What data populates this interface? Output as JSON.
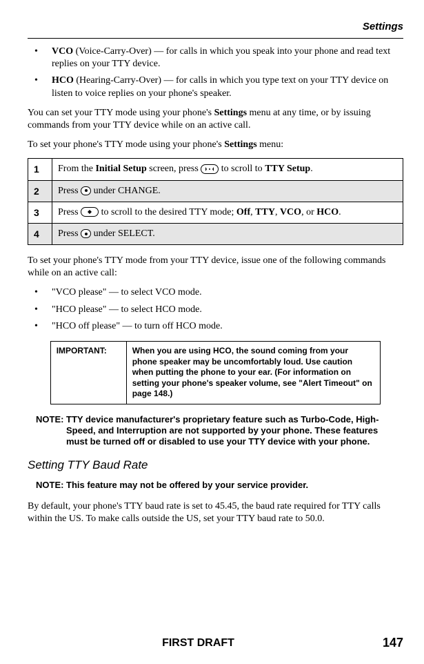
{
  "header": {
    "section": "Settings"
  },
  "bullets_top": [
    {
      "abbr": "VCO",
      "rest": " (Voice-Carry-Over) — for calls in which you speak into your phone and read text replies on your TTY device."
    },
    {
      "abbr": "HCO",
      "rest": " (Hearing-Carry-Over) — for calls in which you type text on your TTY device on listen to voice replies on your phone's speaker."
    }
  ],
  "para_set_mode": {
    "p1_a": "You can set your TTY mode using your phone's ",
    "p1_b": "Settings",
    "p1_c": " menu at any time, or by issuing commands from your TTY device while on an active call.",
    "p2_a": "To set your phone's TTY mode using your phone's ",
    "p2_b": "Settings",
    "p2_c": " menu:"
  },
  "steps": [
    {
      "num": "1",
      "parts": [
        "From the ",
        "Initial Setup",
        " screen, press ",
        "ICON_R",
        " to scroll to ",
        "TTY Setup",
        "."
      ]
    },
    {
      "num": "2",
      "parts": [
        "Press ",
        "ICON_B",
        " under CHANGE."
      ]
    },
    {
      "num": "3",
      "parts": [
        "Press ",
        "ICON_S",
        " to scroll to the desired TTY mode; ",
        "Off",
        ", ",
        "TTY",
        ", ",
        "VCO",
        ", or ",
        "HCO",
        "."
      ]
    },
    {
      "num": "4",
      "parts": [
        "Press ",
        "ICON_B",
        " under SELECT."
      ]
    }
  ],
  "para_set_from_device": "To set your phone's TTY mode from your TTY device, issue one of the following commands while on an active call:",
  "bullets_commands": [
    "\"VCO please\" — to select VCO mode.",
    "\"HCO please\" — to select HCO mode.",
    "\"HCO off please\" — to turn off HCO mode."
  ],
  "important": {
    "label": "IMPORTANT:",
    "text": "When you are using HCO, the sound coming from your phone speaker may be uncomfortably loud. Use caution when putting the phone to your ear. (For information on setting your phone's speaker volume, see \"Alert Timeout\" on page 148.)"
  },
  "note1": "NOTE: TTY device manufacturer's proprietary feature such as Turbo-Code, High-Speed, and Interruption are not supported by your phone. These features must be turned off or disabled to use your TTY device with your phone.",
  "subheading": "Setting TTY Baud Rate",
  "note2": "NOTE: This feature may not be offered by your service provider.",
  "para_baud": "By default, your phone's TTY baud rate is set to 45.45, the baud rate required for TTY calls within the US. To make calls outside the US, set your TTY baud rate to 50.0.",
  "footer": {
    "center": "FIRST DRAFT",
    "page": "147"
  }
}
